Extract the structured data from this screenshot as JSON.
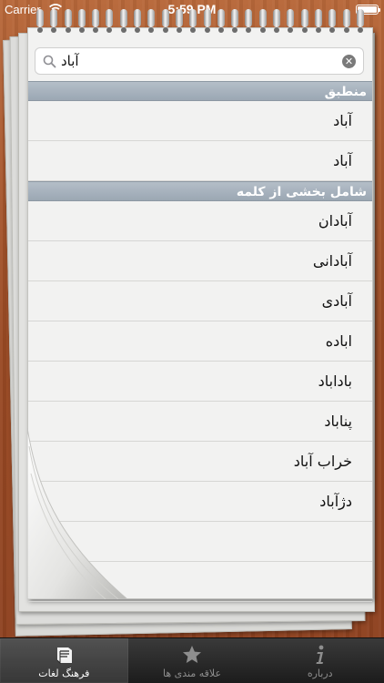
{
  "status_bar": {
    "carrier": "Carrier",
    "time": "5:59 PM"
  },
  "search": {
    "value": "آباد",
    "clear_icon": "clear-icon",
    "search_icon": "search-icon"
  },
  "sections": [
    {
      "header": "منطبق",
      "items": [
        "آباد",
        "آباد"
      ]
    },
    {
      "header": "شامل بخشی از کلمه",
      "items": [
        "آبادان",
        "آبادانی",
        "آبادی",
        "اباده",
        "باداباد",
        "پناباد",
        "خراب آباد",
        "دژآباد"
      ]
    }
  ],
  "tab_bar": {
    "tabs": [
      {
        "label": "فرهنگ لغات",
        "icon": "book-icon",
        "active": true
      },
      {
        "label": "علاقه مندی ها",
        "icon": "star-icon",
        "active": false
      },
      {
        "label": "درباره",
        "icon": "info-icon",
        "active": false
      }
    ]
  },
  "colors": {
    "section_header": "#a7b2bd",
    "tab_active_text": "#ffffff",
    "tab_inactive_text": "#8e8e8e"
  }
}
